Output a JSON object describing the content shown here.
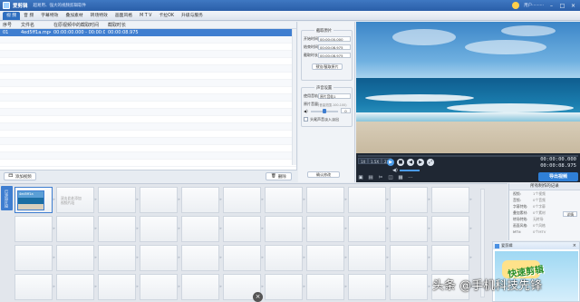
{
  "window": {
    "app_name": "爱剪辑",
    "slogan": "超易用、强大的视频剪辑软件",
    "user_name": "用户·········"
  },
  "tabs": [
    "视 频",
    "音 频",
    "字幕特效",
    "叠加素材",
    "转场特效",
    "画面风格",
    "M T V",
    "卡拉OK",
    "升级与服务"
  ],
  "clip_list": {
    "headers": [
      "序号",
      "文件名",
      "在原视频中的截取时间",
      "截取时长",
      ""
    ],
    "rows": [
      [
        "01",
        "4ed5ff1a.mp4",
        "00:00:00.000 - 00:00:00.000",
        "00:00:08.975",
        ""
      ]
    ],
    "add_button": "添加视频",
    "delete_button": "删除"
  },
  "settings": {
    "clip_group_title": "截取原片",
    "start_label": "开始时间:",
    "start_value": "00:00:00.000",
    "end_label": "结束时间:",
    "end_value": "00:00:08.975",
    "duration_label": "截取时长:",
    "duration_value": "00:00:08.975",
    "preview_button": "预览/截取原片",
    "sound_group_title": "声音设置",
    "track_label": "使用音轨:",
    "track_value": "原片音轨1",
    "volume_label": "原片音量:",
    "volume_value": "0",
    "volume_hint": "(音量范围-100-100)",
    "headtail_label": "头尾声音淡入淡出",
    "confirm_button": "确认修改"
  },
  "player": {
    "elapsed": "00:00:00.000",
    "total": "00:00:08.975",
    "speed_options": [
      "1X",
      "1.5X",
      "2X"
    ],
    "progress_fraction": 0.0,
    "export_button": "导出视频"
  },
  "timeline": {
    "side_label": "已添加片段",
    "clip_title": "4ed5ff1a",
    "empty_meta": [
      "双击此处添加",
      "视频片段"
    ]
  },
  "info_panel": {
    "title": "所有制作的记录",
    "rows": [
      {
        "k": "视频:",
        "v": "1个视频"
      },
      {
        "k": "音频:",
        "v": "0个音频"
      },
      {
        "k": "字幕特效:",
        "v": "0个字幕"
      },
      {
        "k": "叠加素材:",
        "v": "0个素材"
      },
      {
        "k": "转场特效:",
        "v": "无转场"
      },
      {
        "k": "画面风格:",
        "v": "0个风格"
      },
      {
        "k": "MTV:",
        "v": "0个MTV"
      }
    ],
    "button": "详情"
  },
  "ad": {
    "header": "爱剪辑",
    "banner_text": "快速剪辑"
  },
  "watermark": "头条 @手机科技先锋",
  "colors": {
    "accent": "#2f6fc0",
    "selected_row": "#3f7ed0",
    "export": "#2f7fd6"
  }
}
